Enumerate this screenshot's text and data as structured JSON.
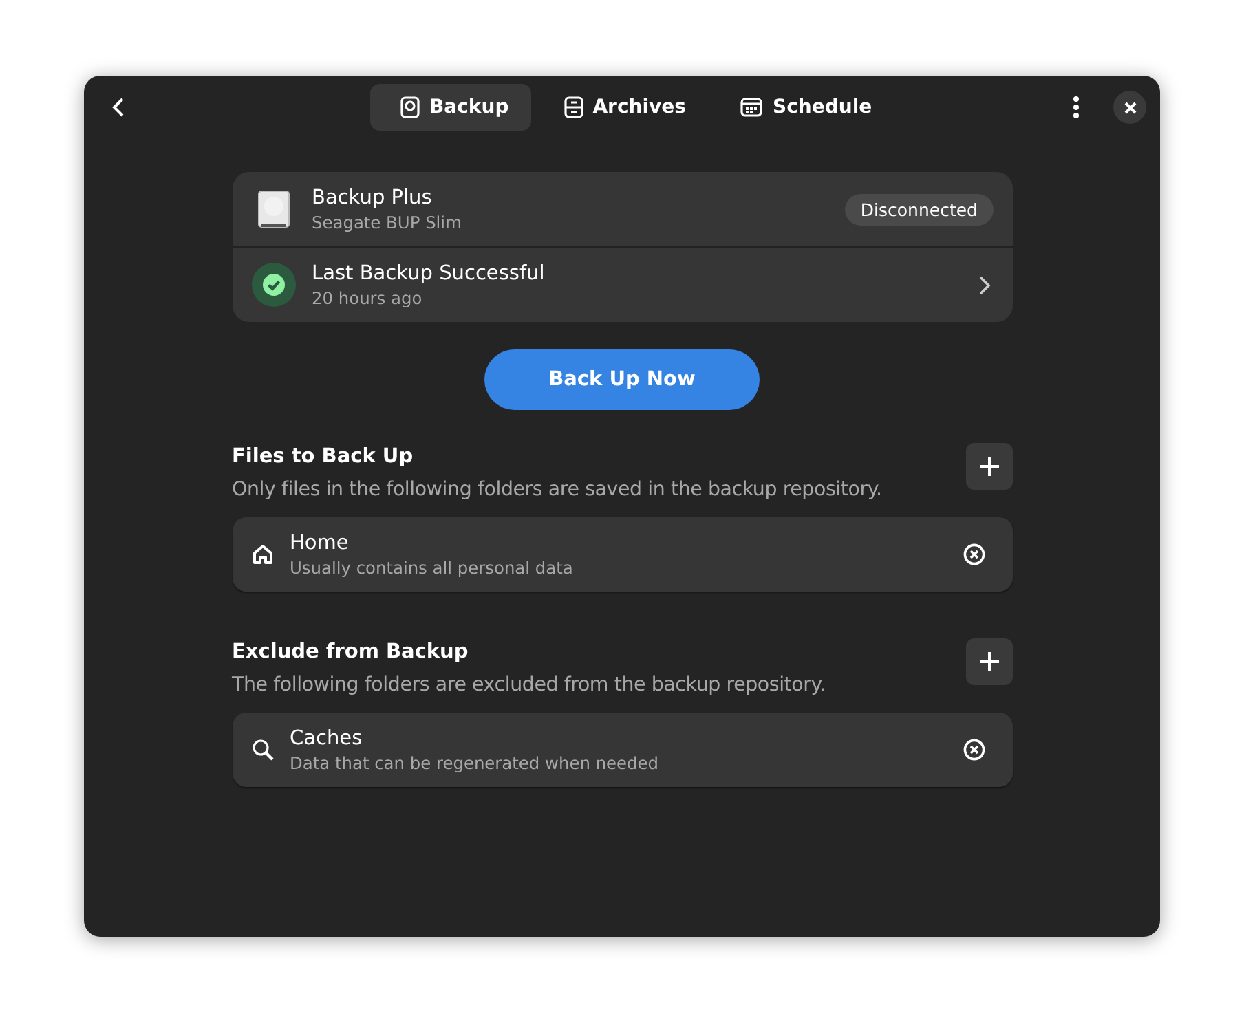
{
  "tabs": [
    {
      "label": "Backup",
      "selected": true
    },
    {
      "label": "Archives",
      "selected": false
    },
    {
      "label": "Schedule",
      "selected": false
    }
  ],
  "device": {
    "name": "Backup Plus",
    "model": "Seagate BUP Slim",
    "status": "Disconnected"
  },
  "last_backup": {
    "title": "Last Backup Successful",
    "time": "20 hours ago"
  },
  "action_button": "Back Up Now",
  "sections": [
    {
      "title": "Files to Back Up",
      "description": "Only files in the following folders are saved in the backup repository.",
      "folders": [
        {
          "name": "Home",
          "description": "Usually contains all personal data"
        }
      ]
    },
    {
      "title": "Exclude from Backup",
      "description": "The following folders are excluded from the backup repository.",
      "folders": [
        {
          "name": "Caches",
          "description": "Data that can be regenerated when needed"
        }
      ]
    }
  ]
}
